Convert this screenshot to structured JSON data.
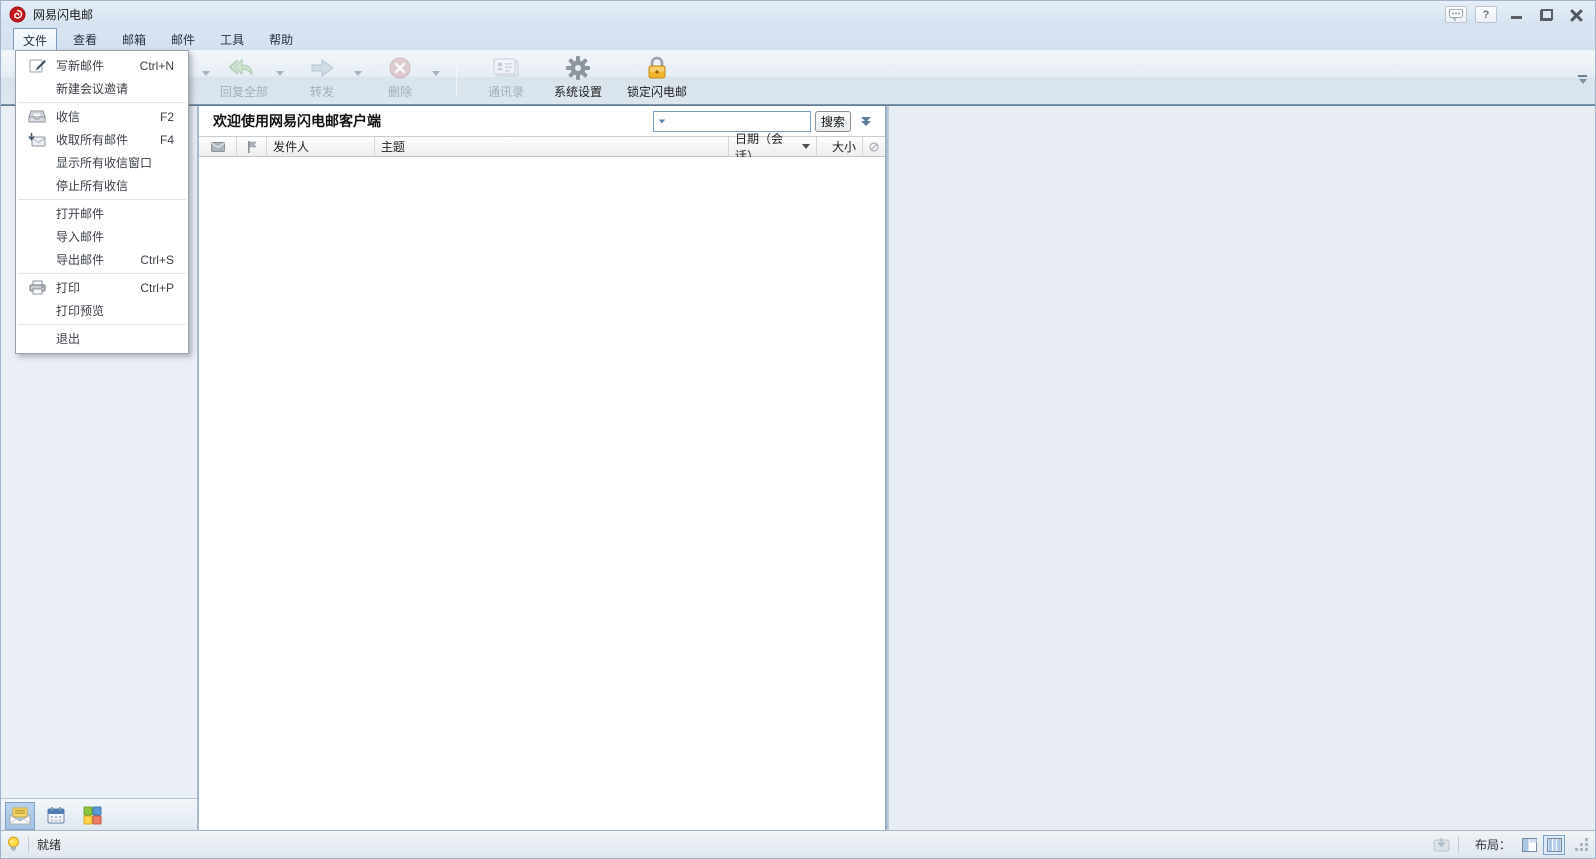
{
  "window": {
    "title": "网易闪电邮"
  },
  "titlebar": {
    "help_glyph": "?",
    "icons": [
      "feedback-bubble-icon",
      "help-icon",
      "minimize-icon",
      "restore-icon",
      "close-icon"
    ]
  },
  "menubar": {
    "items": [
      {
        "label": "文件",
        "active": true
      },
      {
        "label": "查看",
        "active": false
      },
      {
        "label": "邮箱",
        "active": false
      },
      {
        "label": "邮件",
        "active": false
      },
      {
        "label": "工具",
        "active": false
      },
      {
        "label": "帮助",
        "active": false
      }
    ]
  },
  "toolbar": {
    "buttons": [
      {
        "label": "回复全部",
        "icon": "reply-all-icon",
        "disabled": true,
        "dropdown": true
      },
      {
        "label": "转发",
        "icon": "forward-icon",
        "disabled": true,
        "dropdown": true
      },
      {
        "label": "删除",
        "icon": "delete-icon",
        "disabled": true,
        "dropdown": true
      },
      {
        "label": "通讯录",
        "icon": "contacts-icon",
        "disabled": true,
        "dropdown": false
      },
      {
        "label": "系统设置",
        "icon": "gear-icon",
        "disabled": false,
        "dropdown": false
      },
      {
        "label": "锁定闪电邮",
        "icon": "lock-icon",
        "disabled": false,
        "dropdown": false
      }
    ]
  },
  "file_menu": {
    "items": [
      {
        "label": "写新邮件",
        "shortcut": "Ctrl+N",
        "icon": "compose-icon"
      },
      {
        "label": "新建会议邀请",
        "shortcut": "",
        "icon": ""
      },
      {
        "label": "收信",
        "shortcut": "F2",
        "icon": "inbox-icon"
      },
      {
        "label": "收取所有邮件",
        "shortcut": "F4",
        "icon": "inbox-all-icon"
      },
      {
        "label": "显示所有收信窗口",
        "shortcut": "",
        "icon": ""
      },
      {
        "label": "停止所有收信",
        "shortcut": "",
        "icon": ""
      },
      {
        "label": "打开邮件",
        "shortcut": "",
        "icon": ""
      },
      {
        "label": "导入邮件",
        "shortcut": "",
        "icon": ""
      },
      {
        "label": "导出邮件",
        "shortcut": "Ctrl+S",
        "icon": ""
      },
      {
        "label": "打印",
        "shortcut": "Ctrl+P",
        "icon": "printer-icon"
      },
      {
        "label": "打印预览",
        "shortcut": "",
        "icon": ""
      },
      {
        "label": "退出",
        "shortcut": "",
        "icon": ""
      }
    ]
  },
  "list_panel": {
    "welcome_text": "欢迎使用网易闪电邮客户端",
    "search": {
      "value": "",
      "button_label": "搜索"
    },
    "columns": {
      "sender": "发件人",
      "subject": "主题",
      "date": "日期（会话）",
      "size": "大小"
    },
    "column_icons": [
      "mail-state-icon",
      "flag-icon",
      "no-attachment-icon"
    ]
  },
  "sidebar": {
    "dock_icons": [
      {
        "name": "mail-view-icon",
        "selected": true
      },
      {
        "name": "calendar-view-icon",
        "selected": false
      },
      {
        "name": "plugins-view-icon",
        "selected": false
      }
    ]
  },
  "statusbar": {
    "ready_text": "就绪",
    "layout_label": "布局：",
    "icons": [
      "status-bulb-icon",
      "send-receive-icon",
      "layout-horizontal-icon",
      "layout-vertical-icon"
    ]
  },
  "colors": {
    "accent_blue": "#7d9cbf",
    "disabled_text": "#9fb0bf",
    "lock_gold": "#f2b42c",
    "logo_red": "#c5161d",
    "pane_bg": "#e7edf2"
  }
}
